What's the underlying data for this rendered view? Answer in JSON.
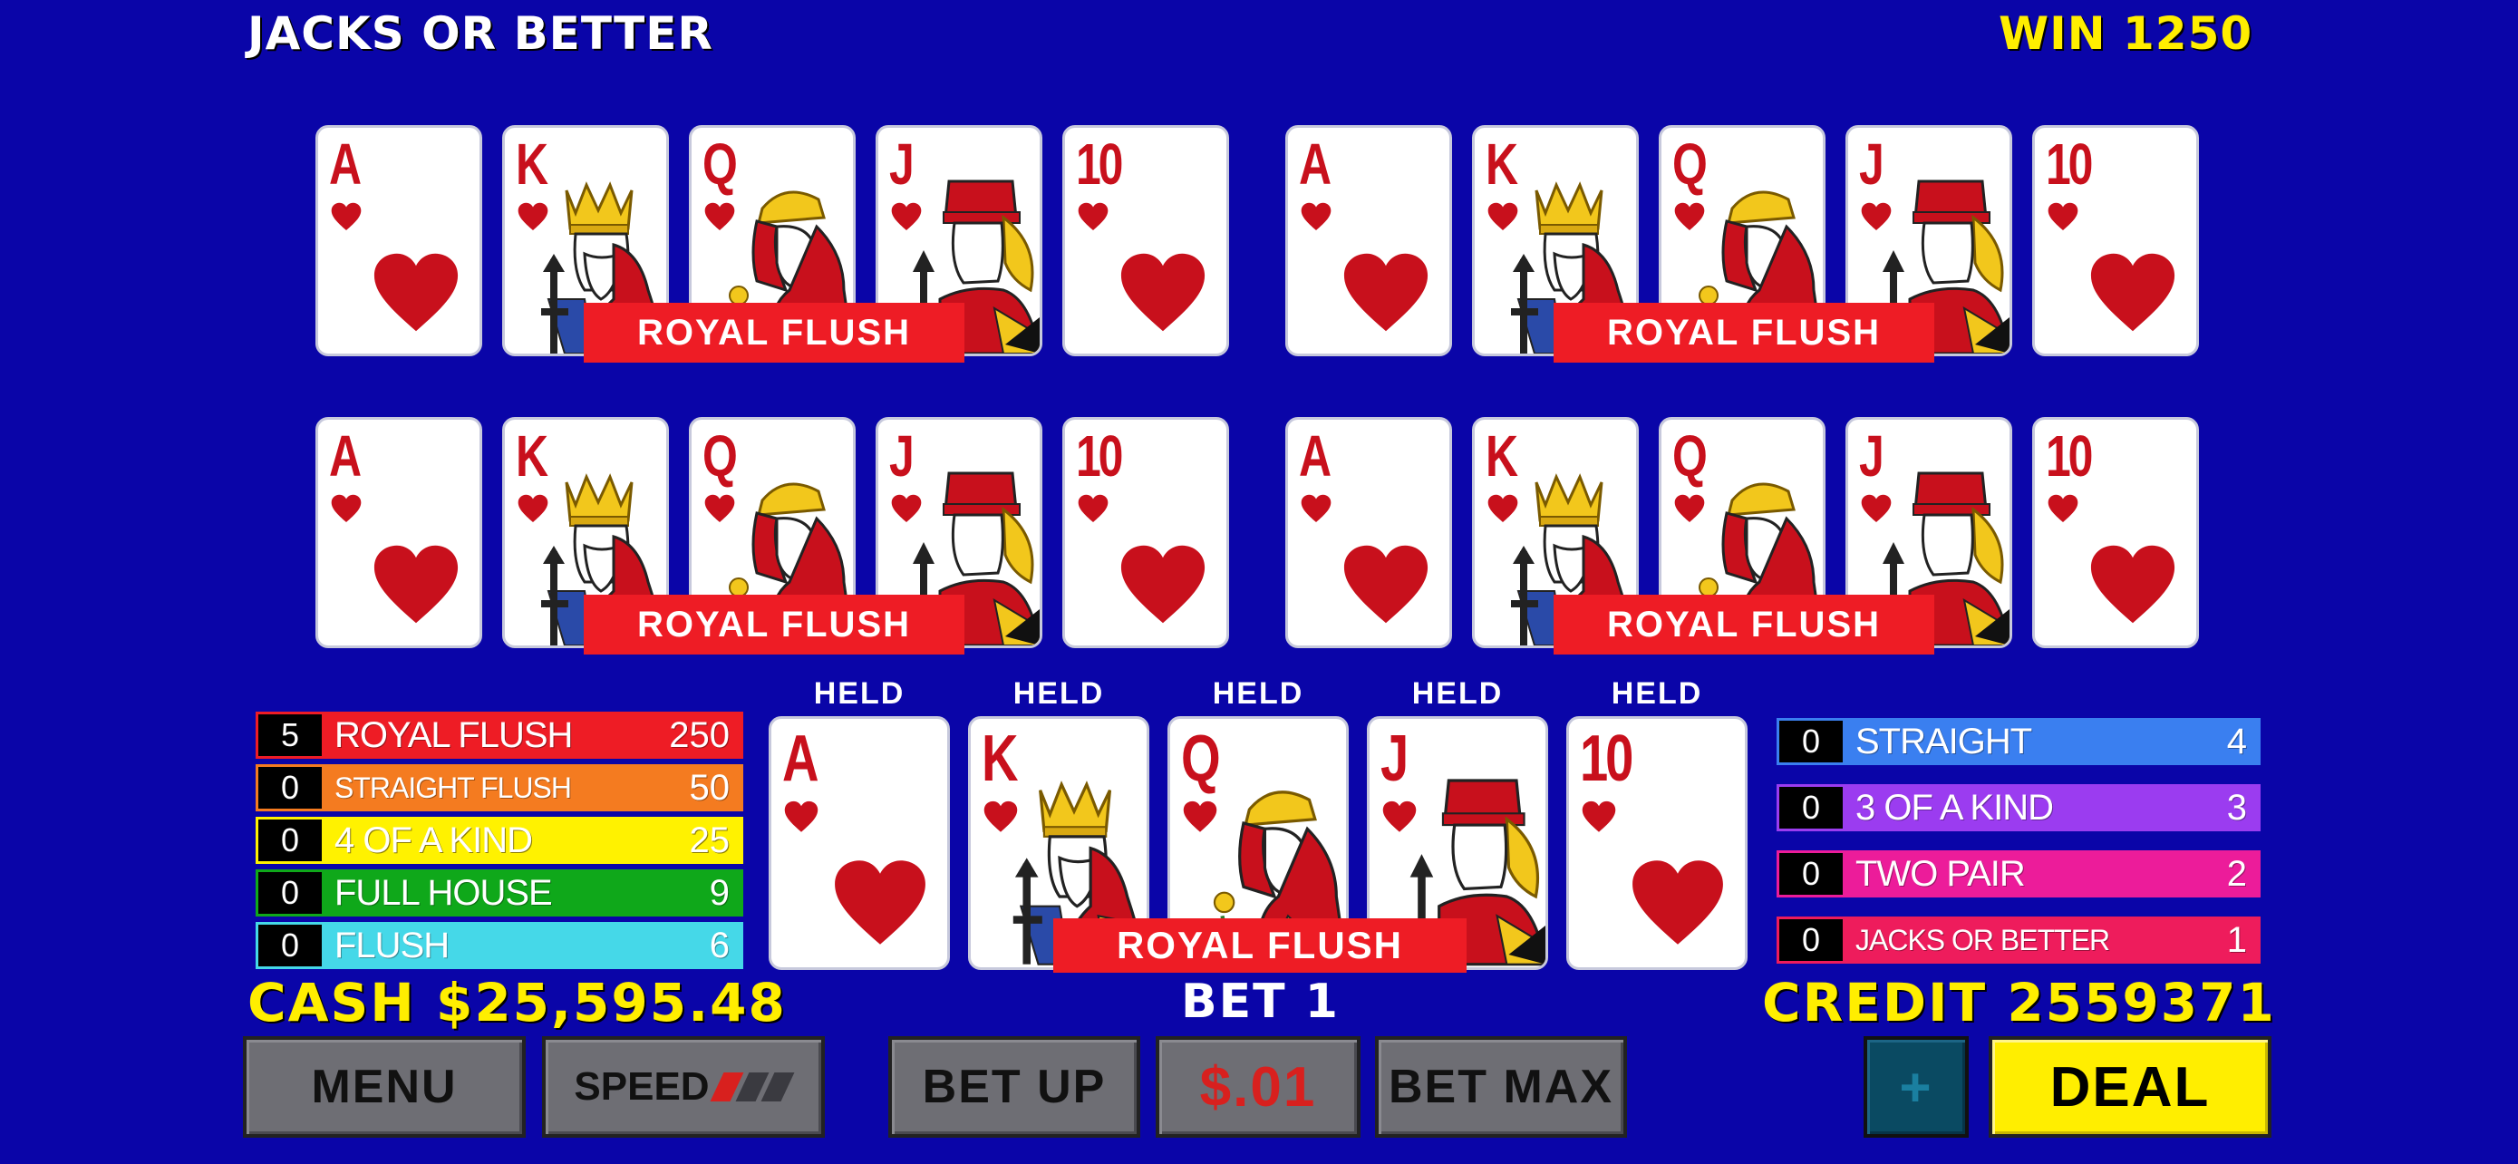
{
  "header": {
    "title": "JACKS OR BETTER",
    "win": "WIN 1250"
  },
  "hands": [
    {
      "cards": [
        "A",
        "K",
        "Q",
        "J",
        "10"
      ],
      "result": "ROYAL FLUSH"
    },
    {
      "cards": [
        "A",
        "K",
        "Q",
        "J",
        "10"
      ],
      "result": "ROYAL FLUSH"
    },
    {
      "cards": [
        "A",
        "K",
        "Q",
        "J",
        "10"
      ],
      "result": "ROYAL FLUSH"
    },
    {
      "cards": [
        "A",
        "K",
        "Q",
        "J",
        "10"
      ],
      "result": "ROYAL FLUSH"
    }
  ],
  "main_hand": {
    "cards": [
      "A",
      "K",
      "Q",
      "J",
      "10"
    ],
    "held_labels": [
      "HELD",
      "HELD",
      "HELD",
      "HELD",
      "HELD"
    ],
    "result": "ROYAL FLUSH"
  },
  "paytable_left": [
    {
      "count": "5",
      "name": "ROYAL FLUSH",
      "pays": "250",
      "color": "#ee1c25"
    },
    {
      "count": "0",
      "name": "STRAIGHT FLUSH",
      "pays": "50",
      "color": "#f47b20"
    },
    {
      "count": "0",
      "name": "4 OF A KIND",
      "pays": "25",
      "color": "#fff200"
    },
    {
      "count": "0",
      "name": "FULL HOUSE",
      "pays": "9",
      "color": "#0fa81a"
    },
    {
      "count": "0",
      "name": "FLUSH",
      "pays": "6",
      "color": "#45d8e8"
    }
  ],
  "paytable_right": [
    {
      "count": "0",
      "name": "STRAIGHT",
      "pays": "4",
      "color": "#3a7ff0"
    },
    {
      "count": "0",
      "name": "3 OF A KIND",
      "pays": "3",
      "color": "#9b3cf0"
    },
    {
      "count": "0",
      "name": "TWO PAIR",
      "pays": "2",
      "color": "#ec1c9a"
    },
    {
      "count": "0",
      "name": "JACKS OR BETTER",
      "pays": "1",
      "color": "#ee1c5c"
    }
  ],
  "status": {
    "cash": "CASH $25,595.48",
    "bet": "BET 1",
    "credit": "CREDIT 2559371"
  },
  "buttons": {
    "menu": "MENU",
    "speed": "SPEED",
    "bet_up": "BET UP",
    "denom": "$.01",
    "bet_max": "BET MAX",
    "plus": "+",
    "deal": "DEAL"
  },
  "colors": {
    "background": "#0a05a8",
    "accent_yellow": "#ffee00",
    "card_red": "#c8101c",
    "label_red": "#ee1c25"
  }
}
